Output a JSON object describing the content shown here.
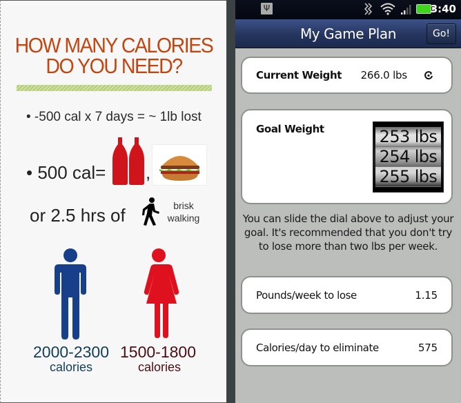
{
  "infographic": {
    "title_line1": "HOW MANY CALORIES",
    "title_line2": "DO YOU NEED?",
    "bullet_1": "• -500 cal x 7 days = ~ 1lb lost",
    "bullet_2": "• 500 cal=",
    "comma": ",",
    "walk_text": "or 2.5 hrs of",
    "brisk_walking": "brisk walking",
    "male_range": "2000-2300",
    "male_unit": "calories",
    "female_range": "1500-1800",
    "female_unit": "calories",
    "colors": {
      "title": "#c4440e",
      "male": "#173f8a",
      "female": "#e0111e"
    }
  },
  "status_bar": {
    "time": "3:40",
    "icons": [
      "usb-icon",
      "vibrate-icon",
      "wifi-icon",
      "signal-icon",
      "battery-icon"
    ]
  },
  "header": {
    "title": "My Game Plan",
    "go_label": "Go!"
  },
  "current_weight": {
    "label": "Current Weight",
    "value": "266.0 lbs"
  },
  "goal_weight": {
    "label": "Goal Weight",
    "dial_options": [
      "253 lbs",
      "254 lbs",
      "255 lbs"
    ],
    "selected": "254 lbs"
  },
  "hint": "You can slide the dial above to adjust your goal. It's recommended that you don't try to lose more than two lbs per week.",
  "pounds_per_week": {
    "label": "Pounds/week to lose",
    "value": "1.15"
  },
  "calories_per_day": {
    "label": "Calories/day to eliminate",
    "value": "575"
  }
}
